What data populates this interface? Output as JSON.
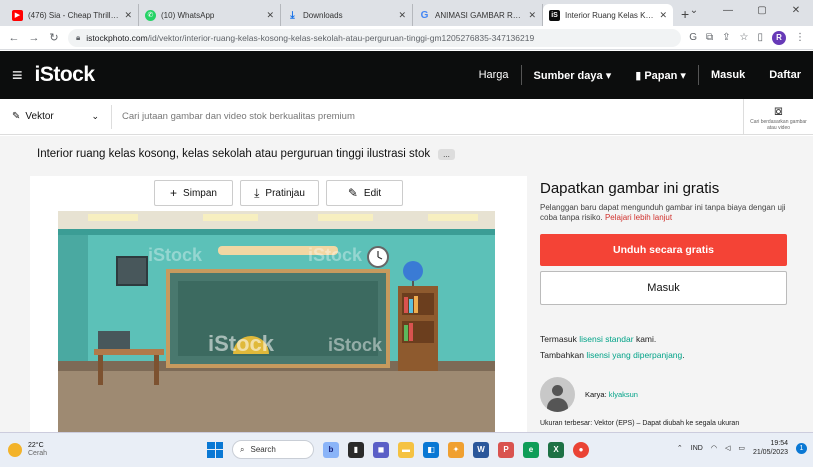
{
  "browser": {
    "tabs": [
      {
        "title": "(476) Sia - Cheap Thrills (Lyri",
        "favicon_color": "#ff0000",
        "favicon": "youtube-icon"
      },
      {
        "title": "(10) WhatsApp",
        "favicon_color": "#25d366",
        "favicon": "whatsapp-icon"
      },
      {
        "title": "Downloads",
        "favicon_color": "#1a73e8",
        "favicon": "download-icon"
      },
      {
        "title": "ANIMASI GAMBAR RUANG K",
        "favicon_color": "#4285f4",
        "favicon": "google-icon"
      },
      {
        "title": "Interior Ruang Kelas Koson",
        "favicon_color": "#0c0d0d",
        "favicon": "istock-icon"
      }
    ],
    "url_host": "istockphoto.com",
    "url_path": "/id/vektor/interior-ruang-kelas-kosong-kelas-sekolah-atau-perguruan-tinggi-gm1205276835-347136219",
    "profile_initial": "R"
  },
  "site": {
    "logo": "iStock",
    "nav": {
      "pricing": "Harga",
      "resources": "Sumber daya",
      "boards": "Papan",
      "login": "Masuk",
      "register": "Daftar"
    }
  },
  "search": {
    "type": "Vektor",
    "placeholder": "Cari jutaan gambar dan video stok berkualitas premium",
    "visual_search": "Cari berdasarkan gambar atau video"
  },
  "asset": {
    "title": "Interior ruang kelas kosong, kelas sekolah atau perguruan tinggi ilustrasi stok",
    "more": "...",
    "actions": {
      "save": "Simpan",
      "preview": "Pratinjau",
      "edit": "Edit"
    },
    "watermark": "iStock"
  },
  "offer": {
    "heading": "Dapatkan gambar ini gratis",
    "desc": "Pelanggan baru dapat mengunduh gambar ini tanpa biaya dengan uji coba tanpa risiko.",
    "learn_more": "Pelajari lebih lanjut",
    "download_btn": "Unduh secara gratis",
    "login_btn": "Masuk",
    "license_pre": "Termasuk",
    "license_link": "lisensi standar",
    "license_post": "kami.",
    "extend_pre": "Tambahkan",
    "extend_link": "lisensi yang diperpanjang",
    "extend_post": ".",
    "artist_label": "Karya:",
    "artist_name": "klyaksun",
    "size_info": "Ukuran terbesar: Vektor (EPS) – Dapat diubah ke segala ukuran"
  },
  "taskbar": {
    "temp": "22°C",
    "weather": "Cerah",
    "search": "Search",
    "lang": "IND",
    "time": "19:54",
    "date": "21/05/2023"
  },
  "colors": {
    "accent_red": "#f44336",
    "link_green": "#02a388",
    "header_bg": "#0c0d0d"
  }
}
